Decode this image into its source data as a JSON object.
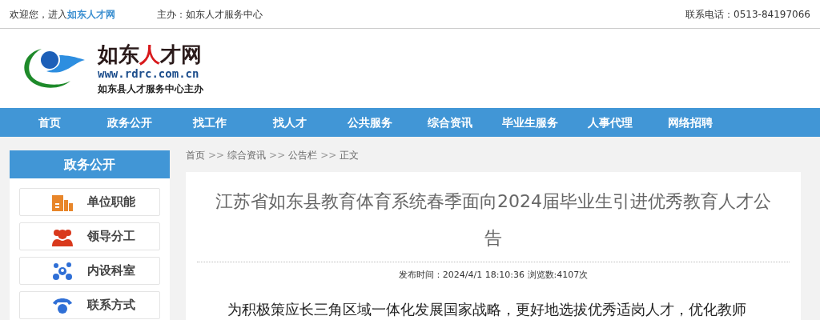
{
  "top_bar": {
    "welcome": "欢迎您，进入",
    "site_link": "如东人才网",
    "host": "主办：如东人才服务中心",
    "phone": "联系电话：0513-84197066"
  },
  "logo": {
    "name_parts": [
      {
        "text": "如东",
        "kind": "dark"
      },
      {
        "text": "人",
        "kind": "red"
      },
      {
        "text": "才网",
        "kind": "dark"
      }
    ],
    "url": "www.rdrc.com.cn",
    "tagline": "如东县人才服务中心主办"
  },
  "nav": [
    "首页",
    "政务公开",
    "找工作",
    "找人才",
    "公共服务",
    "综合资讯",
    "毕业生服务",
    "人事代理",
    "网络招聘"
  ],
  "sidebar": {
    "title": "政务公开",
    "items": [
      {
        "label": "单位职能",
        "kind": "building"
      },
      {
        "label": "领导分工",
        "kind": "people"
      },
      {
        "label": "内设科室",
        "kind": "network"
      },
      {
        "label": "联系方式",
        "kind": "phone"
      }
    ]
  },
  "breadcrumb": [
    {
      "text": "首页",
      "kind": "link"
    },
    {
      "text": ">>",
      "kind": "sep"
    },
    {
      "text": "综合资讯",
      "kind": "link"
    },
    {
      "text": ">>",
      "kind": "sep"
    },
    {
      "text": "公告栏",
      "kind": "link"
    },
    {
      "text": ">>",
      "kind": "sep"
    },
    {
      "text": "正文",
      "kind": "link"
    }
  ],
  "article": {
    "title": "江苏省如东县教育体育系统春季面向2024届毕业生引进优秀教育人才公告",
    "meta": "发布时间：2024/4/1 18:10:36 浏览数:4107次",
    "body": "为积极策应长三角区域一体化发展国家战略，更好地选拔优秀适岗人才，优化教师"
  }
}
